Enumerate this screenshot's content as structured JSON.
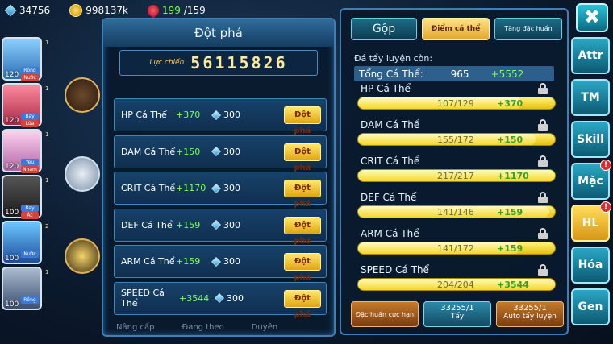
{
  "topbar": {
    "gems": "34756",
    "gold": "998137k",
    "energy": "199",
    "energy_max": "/159"
  },
  "pets": [
    {
      "level": "120",
      "tag1": "Rồng",
      "tag2": "Nước",
      "nums": "1"
    },
    {
      "level": "120",
      "tag1": "Bay",
      "tag2": "Lửa",
      "nums": "1"
    },
    {
      "level": "120",
      "tag1": "Yêu",
      "tag2": "Nham",
      "nums": "1"
    },
    {
      "level": "100",
      "tag1": "Bay",
      "tag2": "Ác",
      "nums": "1"
    },
    {
      "level": "100",
      "tag1": "Nước",
      "tag2": "",
      "nums": "2"
    },
    {
      "level": "100",
      "tag1": "Rồng",
      "tag2": "",
      "nums": "1"
    }
  ],
  "breakthrough": {
    "title": "Đột phá",
    "power_label": "Lực chiến",
    "power_value": "56115826",
    "rows": [
      {
        "name": "HP Cá Thể",
        "bonus": "+370",
        "cost": "300",
        "button": "Đột phá"
      },
      {
        "name": "DAM Cá Thể",
        "bonus": "+150",
        "cost": "300",
        "button": "Đột phá"
      },
      {
        "name": "CRIT Cá Thể",
        "bonus": "+1170",
        "cost": "300",
        "button": "Đột phá"
      },
      {
        "name": "DEF Cá Thể",
        "bonus": "+159",
        "cost": "300",
        "button": "Đột phá"
      },
      {
        "name": "ARM Cá Thể",
        "bonus": "+159",
        "cost": "300",
        "button": "Đột phá"
      },
      {
        "name": "SPEED Cá Thể",
        "bonus": "+3544",
        "cost": "300",
        "button": "Đột phá"
      }
    ],
    "bottom_tabs": [
      "Nâng cấp",
      "Đang theo",
      "Duyên"
    ]
  },
  "training": {
    "tabs": {
      "gop": "Gộp",
      "diem": "Điểm cá thể",
      "tang": "Tăng đặc huấn"
    },
    "remain_label": "Đá tẩy luyện còn:",
    "total_label": "Tổng Cá Thể:",
    "total_value": "965",
    "total_bonus": "+5552",
    "stats": [
      {
        "name": "HP Cá Thể",
        "progress": "107/129",
        "bonus": "+370",
        "fill": 0.83
      },
      {
        "name": "DAM Cá Thể",
        "progress": "155/172",
        "bonus": "+150",
        "fill": 0.9
      },
      {
        "name": "CRIT Cá Thể",
        "progress": "217/217",
        "bonus": "+1170",
        "fill": 1.0
      },
      {
        "name": "DEF Cá Thể",
        "progress": "141/146",
        "bonus": "+159",
        "fill": 0.97
      },
      {
        "name": "ARM Cá Thể",
        "progress": "141/172",
        "bonus": "+159",
        "fill": 0.82
      },
      {
        "name": "SPEED Cá Thể",
        "progress": "204/204",
        "bonus": "+3544",
        "fill": 1.0
      }
    ],
    "buttons": {
      "dac_huan": "Đặc huấn cực hạn",
      "tay_count": "33255/1",
      "tay_label": "Tẩy",
      "auto_count": "33255/1",
      "auto_label": "Auto tẩy luyện"
    }
  },
  "side_menu": {
    "close": "✖",
    "items": [
      "Attr",
      "TM",
      "Skill",
      "Mặc",
      "HL",
      "Hóa",
      "Gen"
    ]
  }
}
